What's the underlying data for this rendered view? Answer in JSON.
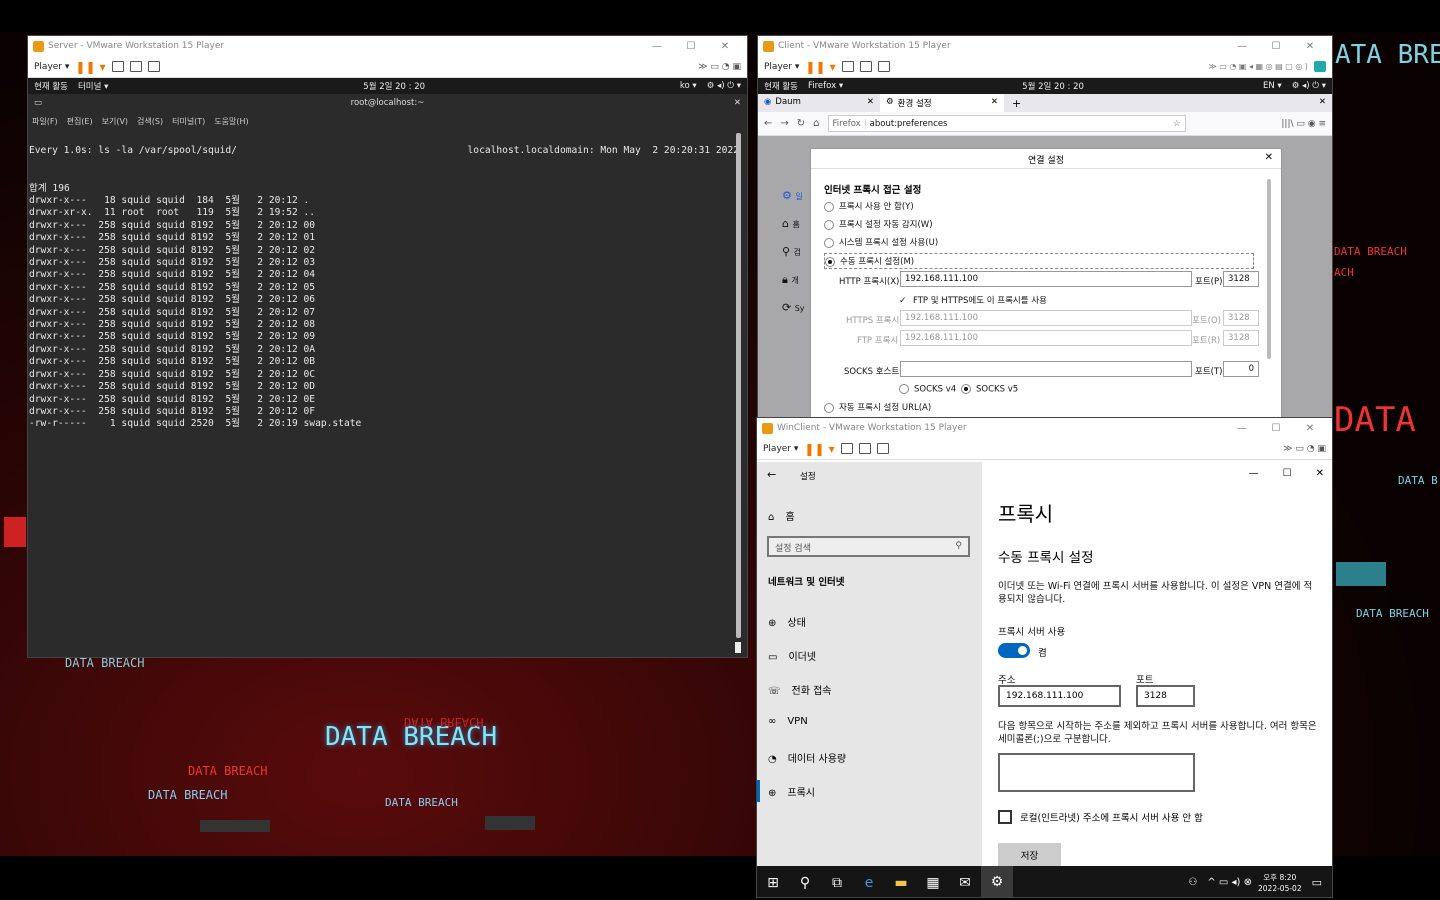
{
  "desktop": {
    "watermarks": [
      "DATA BREACH",
      "DATA BREACH",
      "DATA BREACH",
      "DATA BREACH",
      "DATA BREACH",
      "DATA BREACH",
      "DATA BREACH",
      "DATA",
      "DATA BREACH",
      "DATA BREACH",
      "ATA BREACH",
      "ACH",
      "DATA B"
    ]
  },
  "server": {
    "title": "Server - VMware Workstation 15 Player",
    "player_label": "Player ▾",
    "gnome": {
      "activities": "현재 활동",
      "terminal_menu": "터미널 ▾",
      "clock": "5월 2일  20 : 20",
      "lang": "ko ▾"
    },
    "terminal_title": "root@localhost:~",
    "menu": [
      "파일(F)",
      "편집(E)",
      "보기(V)",
      "검색(S)",
      "터미널(T)",
      "도움말(H)"
    ],
    "watch_header": "Every 1.0s: ls -la /var/spool/squid/",
    "watch_right": "localhost.localdomain: Mon May  2 20:20:31 2022",
    "total": "합계 196",
    "lines": [
      "drwxr-x---   18 squid squid  184  5월   2 20:12 .",
      "drwxr-xr-x.  11 root  root   119  5월   2 19:52 ..",
      "drwxr-x---  258 squid squid 8192  5월   2 20:12 00",
      "drwxr-x---  258 squid squid 8192  5월   2 20:12 01",
      "drwxr-x---  258 squid squid 8192  5월   2 20:12 02",
      "drwxr-x---  258 squid squid 8192  5월   2 20:12 03",
      "drwxr-x---  258 squid squid 8192  5월   2 20:12 04",
      "drwxr-x---  258 squid squid 8192  5월   2 20:12 05",
      "drwxr-x---  258 squid squid 8192  5월   2 20:12 06",
      "drwxr-x---  258 squid squid 8192  5월   2 20:12 07",
      "drwxr-x---  258 squid squid 8192  5월   2 20:12 08",
      "drwxr-x---  258 squid squid 8192  5월   2 20:12 09",
      "drwxr-x---  258 squid squid 8192  5월   2 20:12 0A",
      "drwxr-x---  258 squid squid 8192  5월   2 20:12 0B",
      "drwxr-x---  258 squid squid 8192  5월   2 20:12 0C",
      "drwxr-x---  258 squid squid 8192  5월   2 20:12 0D",
      "drwxr-x---  258 squid squid 8192  5월   2 20:12 0E",
      "drwxr-x---  258 squid squid 8192  5월   2 20:12 0F",
      "-rw-r-----    1 squid squid 2520  5월   2 20:19 swap.state"
    ]
  },
  "client": {
    "title": "Client - VMware Workstation 15 Player",
    "player_label": "Player ▾",
    "gnome": {
      "activities": "현재 활동",
      "app": "Firefox ▾",
      "clock": "5월 2일  20 : 20",
      "lang": "EN ▾"
    },
    "tabs": [
      "Daum",
      "환경 설정"
    ],
    "url_prefix": "Firefox",
    "url": "about:preferences",
    "dialog": {
      "title": "연결 설정",
      "heading": "인터넷 프록시 접근 설정",
      "options": [
        "프록시 사용 안 함(Y)",
        "프록시 설정 자동 감지(W)",
        "시스템 프록시 설정 사용(U)",
        "수동 프록시 설정(M)"
      ],
      "http_label": "HTTP 프록시(X)",
      "http_value": "192.168.111.100",
      "port_label": "포트(P)",
      "http_port": "3128",
      "also_use": "FTP 및 HTTPS에도 이 프록시를 사용",
      "https_label": "HTTPS 프록시",
      "https_value": "192.168.111.100",
      "https_port_label": "포트(O)",
      "https_port": "3128",
      "ftp_label": "FTP 프록시",
      "ftp_value": "192.168.111.100",
      "ftp_port_label": "포트(R)",
      "ftp_port": "3128",
      "socks_label": "SOCKS 호스트",
      "socks_value": "",
      "socks_port_label": "포트(T)",
      "socks_port": "0",
      "socks4": "SOCKS v4",
      "socks5": "SOCKS v5",
      "auto_url": "자동 프록시 설정 URL(A)"
    },
    "side_items": [
      "일",
      "홈",
      "검",
      "개",
      "Sy"
    ]
  },
  "winclient": {
    "title": "WinClient - VMware Workstation 15 Player",
    "player_label": "Player ▾",
    "settings_title": "설정",
    "home": "홈",
    "search_placeholder": "설정 검색",
    "section": "네트워크 및 인터넷",
    "nav": [
      "상태",
      "이더넷",
      "전화 접속",
      "VPN",
      "데이터 사용량",
      "프록시"
    ],
    "page_title": "프록시",
    "manual_title": "수동 프록시 설정",
    "desc": "이더넷 또는 Wi-Fi 연결에 프록시 서버를 사용합니다. 이 설정은 VPN 연결에 적용되지 않습니다.",
    "use_proxy_label": "프록시 서버 사용",
    "toggle_state": "켬",
    "address_label": "주소",
    "address_value": "192.168.111.100",
    "port_label": "포트",
    "port_value": "3128",
    "exceptions_desc": "다음 항목으로 시작하는 주소를 제외하고 프록시 서버를 사용합니다. 여러 항목은 세미콜론(;)으로 구분합니다.",
    "exceptions_value": "",
    "local_bypass": "로컬(인트라넷) 주소에 프록시 서버 사용 안 함",
    "save": "저장",
    "tray_time": "오후 8:20",
    "tray_date": "2022-05-02"
  },
  "colors": {
    "accent": "#0067c0",
    "terminal_bg": "#2b2b2b",
    "vm_orange": "#f07800"
  }
}
